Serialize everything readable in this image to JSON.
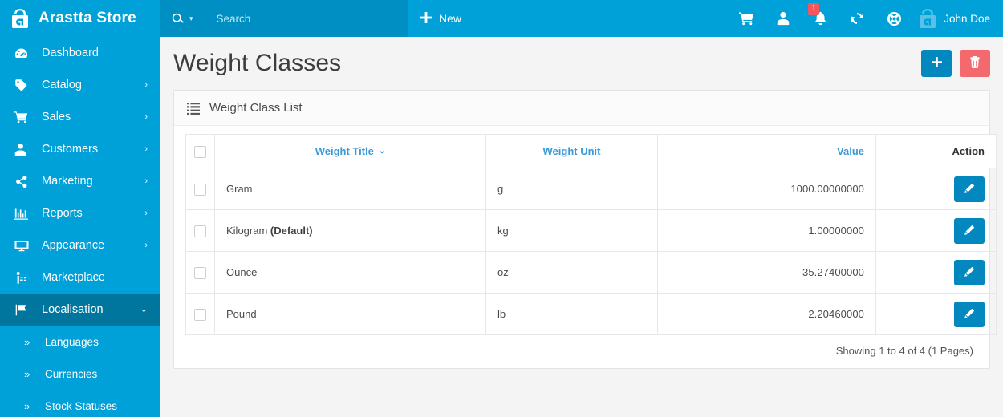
{
  "brand": {
    "name": "Arastta Store",
    "logo_icon": "arastta-bag-logo"
  },
  "sidebar": {
    "items": [
      {
        "label": "Dashboard",
        "icon": "dashboard-icon",
        "caret": "",
        "active": false
      },
      {
        "label": "Catalog",
        "icon": "tag-icon",
        "caret": "›",
        "active": false
      },
      {
        "label": "Sales",
        "icon": "cart-icon",
        "caret": "›",
        "active": false
      },
      {
        "label": "Customers",
        "icon": "user-icon",
        "caret": "›",
        "active": false
      },
      {
        "label": "Marketing",
        "icon": "share-icon",
        "caret": "›",
        "active": false
      },
      {
        "label": "Reports",
        "icon": "bar-chart-icon",
        "caret": "›",
        "active": false
      },
      {
        "label": "Appearance",
        "icon": "monitor-icon",
        "caret": "›",
        "active": false
      },
      {
        "label": "Marketplace",
        "icon": "marketplace-icon",
        "caret": "",
        "active": false
      },
      {
        "label": "Localisation",
        "icon": "flag-icon",
        "caret": "⌄",
        "active": true
      }
    ],
    "subitems": [
      {
        "label": "Languages",
        "icon": "double-chevron-icon"
      },
      {
        "label": "Currencies",
        "icon": "double-chevron-icon"
      },
      {
        "label": "Stock Statuses",
        "icon": "double-chevron-icon"
      }
    ]
  },
  "header": {
    "search": {
      "placeholder": "Search",
      "value": "",
      "icon": "search-icon",
      "caret": "▾"
    },
    "new": {
      "label": "New",
      "plus": "➕"
    },
    "actions": [
      {
        "name": "cart-icon",
        "badge": ""
      },
      {
        "name": "user-icon",
        "badge": ""
      },
      {
        "name": "bell-icon",
        "badge": "1"
      },
      {
        "name": "refresh-icon",
        "badge": ""
      },
      {
        "name": "lifebuoy-icon",
        "badge": ""
      }
    ],
    "user": {
      "name": "John Doe",
      "avatar_icon": "arastta-bag-avatar"
    }
  },
  "page": {
    "title": "Weight Classes",
    "add_button": {
      "icon": "plus-icon",
      "label": ""
    },
    "delete_button": {
      "icon": "trash-icon",
      "label": ""
    }
  },
  "panel": {
    "title": "Weight Class List",
    "icon": "list-icon",
    "columns": [
      {
        "key": "checkbox",
        "label": "",
        "link": false,
        "align": "center"
      },
      {
        "key": "title",
        "label": "Weight Title",
        "link": true,
        "sort_caret": "⌄",
        "align": "left"
      },
      {
        "key": "unit",
        "label": "Weight Unit",
        "link": true,
        "align": "left"
      },
      {
        "key": "value",
        "label": "Value",
        "link": true,
        "align": "right"
      },
      {
        "key": "action",
        "label": "Action",
        "link": false,
        "align": "right"
      }
    ],
    "rows": [
      {
        "title": "Gram",
        "default_tag": "",
        "unit": "g",
        "value": "1000.00000000",
        "action_icon": "pencil-icon"
      },
      {
        "title": "Kilogram",
        "default_tag": "(Default)",
        "unit": "kg",
        "value": "1.00000000",
        "action_icon": "pencil-icon"
      },
      {
        "title": "Ounce",
        "default_tag": "",
        "unit": "oz",
        "value": "35.27400000",
        "action_icon": "pencil-icon"
      },
      {
        "title": "Pound",
        "default_tag": "",
        "unit": "lb",
        "value": "2.20460000",
        "action_icon": "pencil-icon"
      }
    ],
    "footer": "Showing 1 to 4 of 4 (1 Pages)"
  },
  "colors": {
    "brand_blue": "#00a0d8",
    "search_blue": "#008fc2",
    "sidebar_active": "#00769e",
    "button_blue": "#0288be",
    "danger_red": "#f3696d",
    "badge_red": "#f3565d",
    "link_blue": "#3a9ad9",
    "page_bg": "#f4f4f4"
  }
}
